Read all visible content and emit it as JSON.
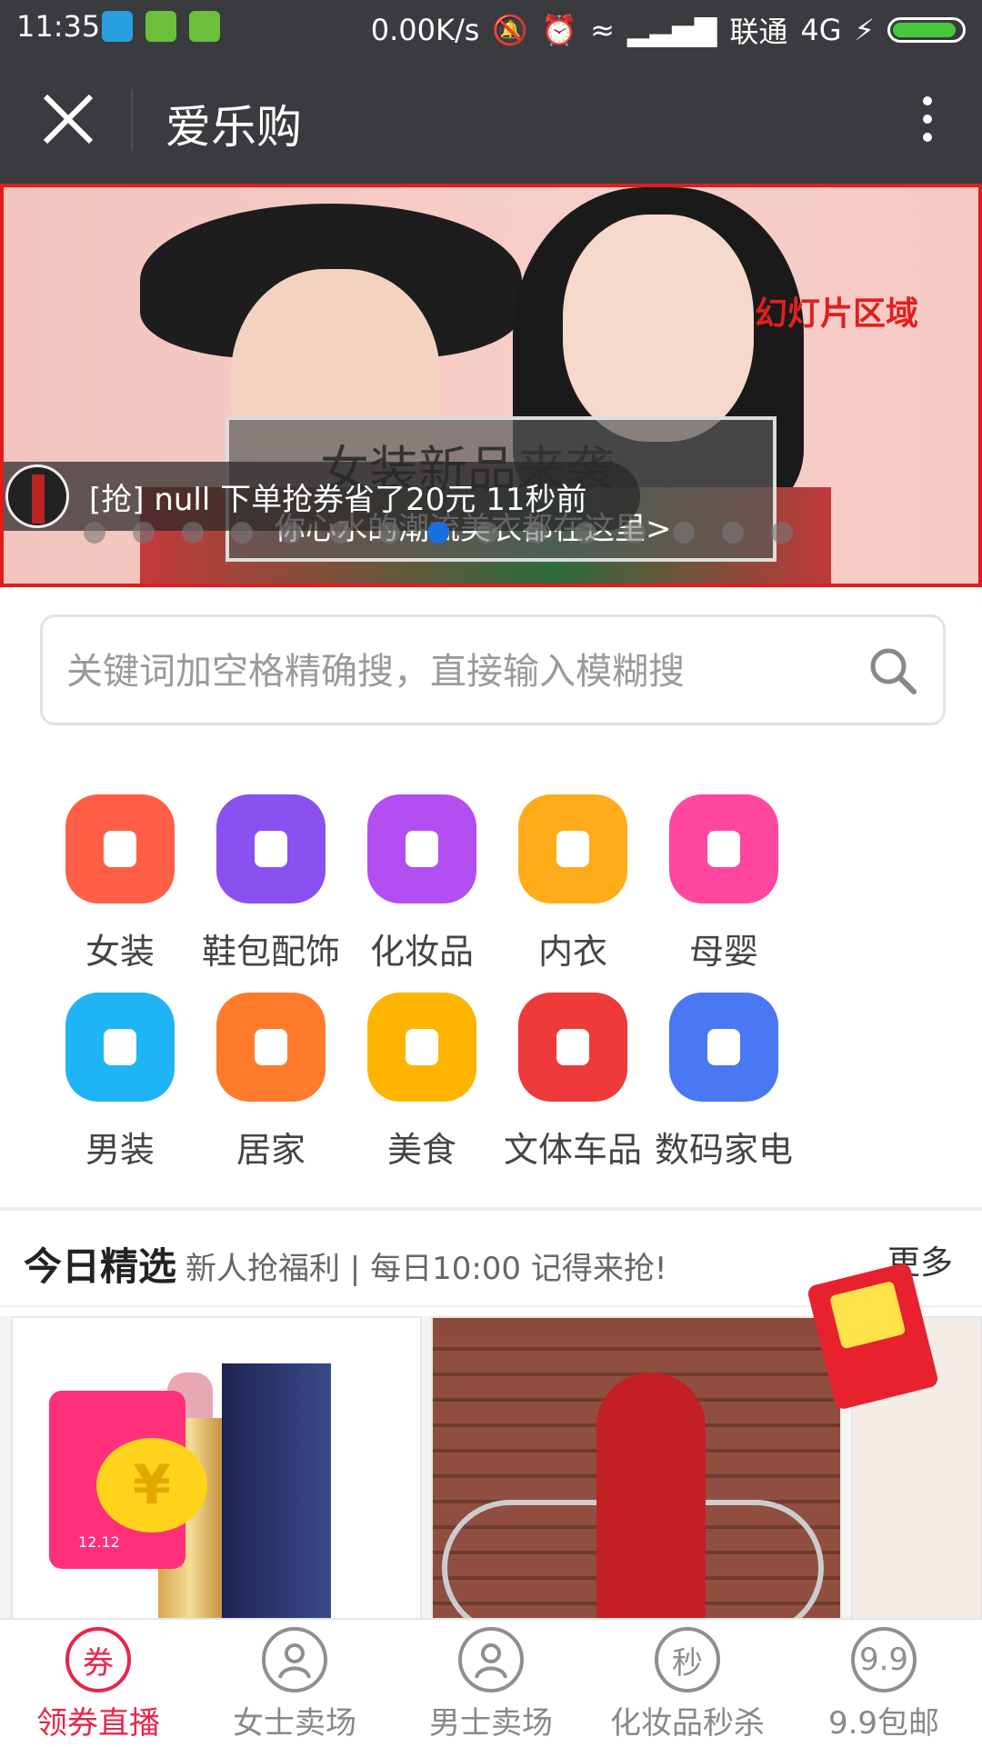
{
  "status_bar": {
    "time": "11:35",
    "net_speed": "0.00K/s",
    "carrier": "联通",
    "network": "4G"
  },
  "header": {
    "title": "爱乐购"
  },
  "banner": {
    "region_label": "幻灯片区域",
    "headline": "女装新品来袭",
    "subline": "你心水的潮流美衣都在这里>",
    "ticker": "[抢] null 下单抢券省了20元    11秒前",
    "slide_count": 15,
    "active_slide": 7
  },
  "search": {
    "placeholder": "关键词加空格精确搜，直接输入模糊搜"
  },
  "categories": [
    {
      "label": "女装",
      "icon": "dress-icon",
      "color": "#ff5f46"
    },
    {
      "label": "鞋包配饰",
      "icon": "shoe-bag-icon",
      "color": "#8a50f0"
    },
    {
      "label": "化妆品",
      "icon": "cosmetics-icon",
      "color": "#b34ef0"
    },
    {
      "label": "内衣",
      "icon": "bra-icon",
      "color": "#ffac1a"
    },
    {
      "label": "母婴",
      "icon": "baby-bottle-icon",
      "color": "#ff47a0"
    },
    {
      "label": "男装",
      "icon": "tshirt-icon",
      "color": "#1fb4f5"
    },
    {
      "label": "居家",
      "icon": "basket-icon",
      "color": "#ff7a2a"
    },
    {
      "label": "美食",
      "icon": "food-icon",
      "color": "#ffb400"
    },
    {
      "label": "文体车品",
      "icon": "car-icon",
      "color": "#ee3a3a"
    },
    {
      "label": "数码家电",
      "icon": "washer-icon",
      "color": "#4a78f2"
    }
  ],
  "today": {
    "title": "今日精选",
    "subtitle": "新人抢福利 | 每日10:00 记得来抢!",
    "more": "更多"
  },
  "promo": {
    "coin_symbol": "¥",
    "packet_date": "12.12"
  },
  "bottom_nav": [
    {
      "label": "领券直播",
      "icon_text": "券",
      "icon": "coupon-icon",
      "active": true
    },
    {
      "label": "女士卖场",
      "icon_text": "",
      "icon": "woman-user-icon",
      "active": false
    },
    {
      "label": "男士卖场",
      "icon_text": "",
      "icon": "man-user-icon",
      "active": false
    },
    {
      "label": "化妆品秒杀",
      "icon_text": "秒",
      "icon": "flash-sale-icon",
      "active": false
    },
    {
      "label": "9.9包邮",
      "icon_text": "9.9",
      "icon": "badge-99-icon",
      "active": false
    }
  ],
  "colors": {
    "accent": "#e8254a",
    "header_bg": "#3a3b3e",
    "banner_border": "#e31b1b"
  }
}
